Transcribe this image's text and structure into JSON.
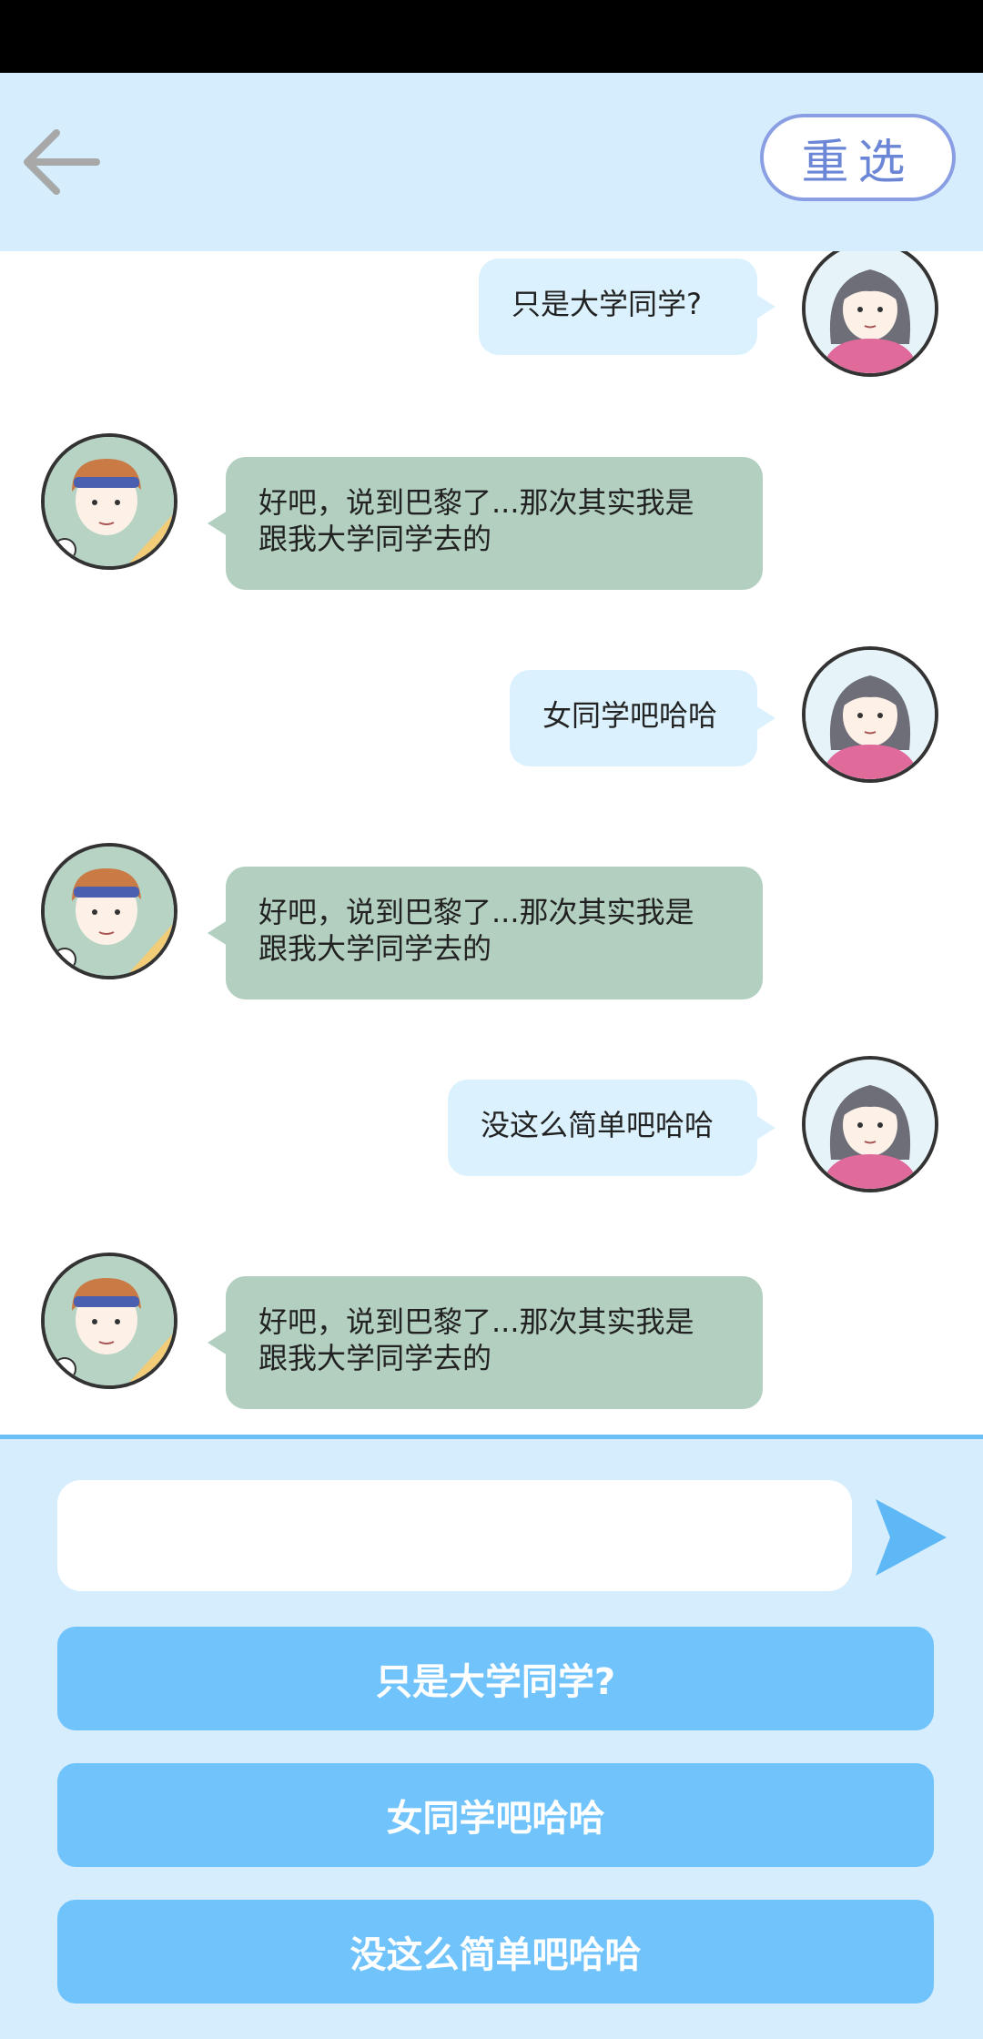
{
  "header": {
    "reselect_label": "重选"
  },
  "messages": [
    {
      "side": "me",
      "text": "只是大学同学?"
    },
    {
      "side": "them",
      "text": "好吧，说到巴黎了...那次其实我是\n跟我大学同学去的"
    },
    {
      "side": "me",
      "text": "女同学吧哈哈"
    },
    {
      "side": "them",
      "text": "好吧，说到巴黎了...那次其实我是\n跟我大学同学去的"
    },
    {
      "side": "me",
      "text": "没这么简单吧哈哈"
    },
    {
      "side": "them",
      "text": "好吧，说到巴黎了...那次其实我是\n跟我大学同学去的"
    }
  ],
  "input": {
    "value": ""
  },
  "options": [
    "只是大学同学?",
    "女同学吧哈哈",
    "没这么简单吧哈哈"
  ],
  "colors": {
    "header_bg": "#d6edfd",
    "me_bubble": "#dbf2fe",
    "them_bubble": "#b2cfc0",
    "option_bg": "#70c3fb",
    "send_icon": "#5db8f5"
  }
}
